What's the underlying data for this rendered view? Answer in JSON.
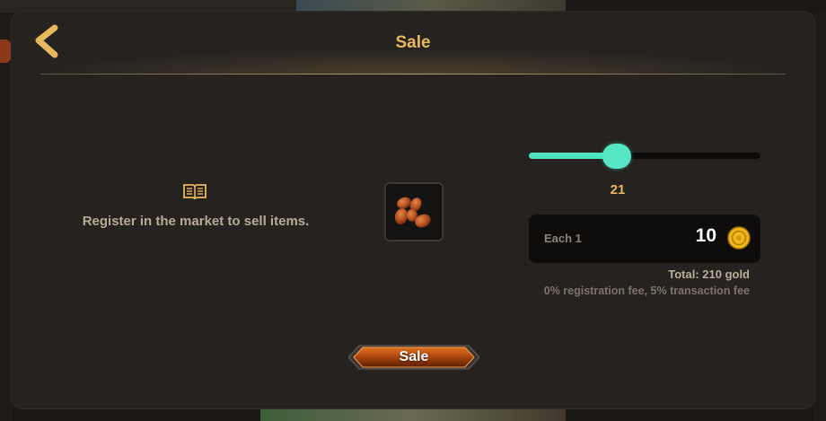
{
  "header": {
    "title": "Sale",
    "back_icon": "chevron-left-icon"
  },
  "register": {
    "icon": "book-icon",
    "message": "Register in the market to sell items."
  },
  "item": {
    "icon": "almonds-icon"
  },
  "quantity": {
    "value": "21",
    "slider_fraction": 0.38,
    "accent_color": "#4fe3bd"
  },
  "price": {
    "each_label": "Each 1",
    "value": "10",
    "currency_icon": "gold-coin-icon"
  },
  "summary": {
    "total": "Total: 210 gold",
    "fees": "0% registration fee, 5% transaction fee"
  },
  "action": {
    "sale_label": "Sale"
  },
  "colors": {
    "panel": "#252220",
    "gold_text": "#e8b95c",
    "button": "#b84a10"
  }
}
